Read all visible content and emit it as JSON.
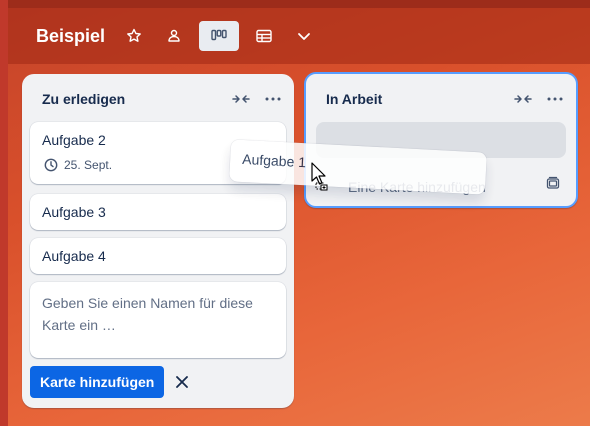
{
  "header": {
    "title": "Beispiel",
    "star_icon": "star-icon",
    "visibility_icon": "people-icon",
    "board_view_icon": "board-view-icon",
    "table_view_icon": "table-view-icon",
    "more_icon": "chevron-down-icon"
  },
  "lists": [
    {
      "title": "Zu erledigen",
      "cards": [
        {
          "title": "Aufgabe 2",
          "due": "25. Sept."
        },
        {
          "title": "Aufgabe 3"
        },
        {
          "title": "Aufgabe 4"
        }
      ],
      "composer_placeholder": "Geben Sie einen Namen für diese Karte ein …",
      "add_button": "Karte hinzufügen"
    },
    {
      "title": "In Arbeit",
      "add_card_label": "Eine Karte hinzufügen"
    }
  ],
  "dragging_card": {
    "title": "Aufgabe 1"
  },
  "colors": {
    "board_gradient_start": "#c4432a",
    "board_gradient_end": "#ec7b4a",
    "primary_button": "#0c66e4",
    "drop_target_border": "#579dff"
  }
}
